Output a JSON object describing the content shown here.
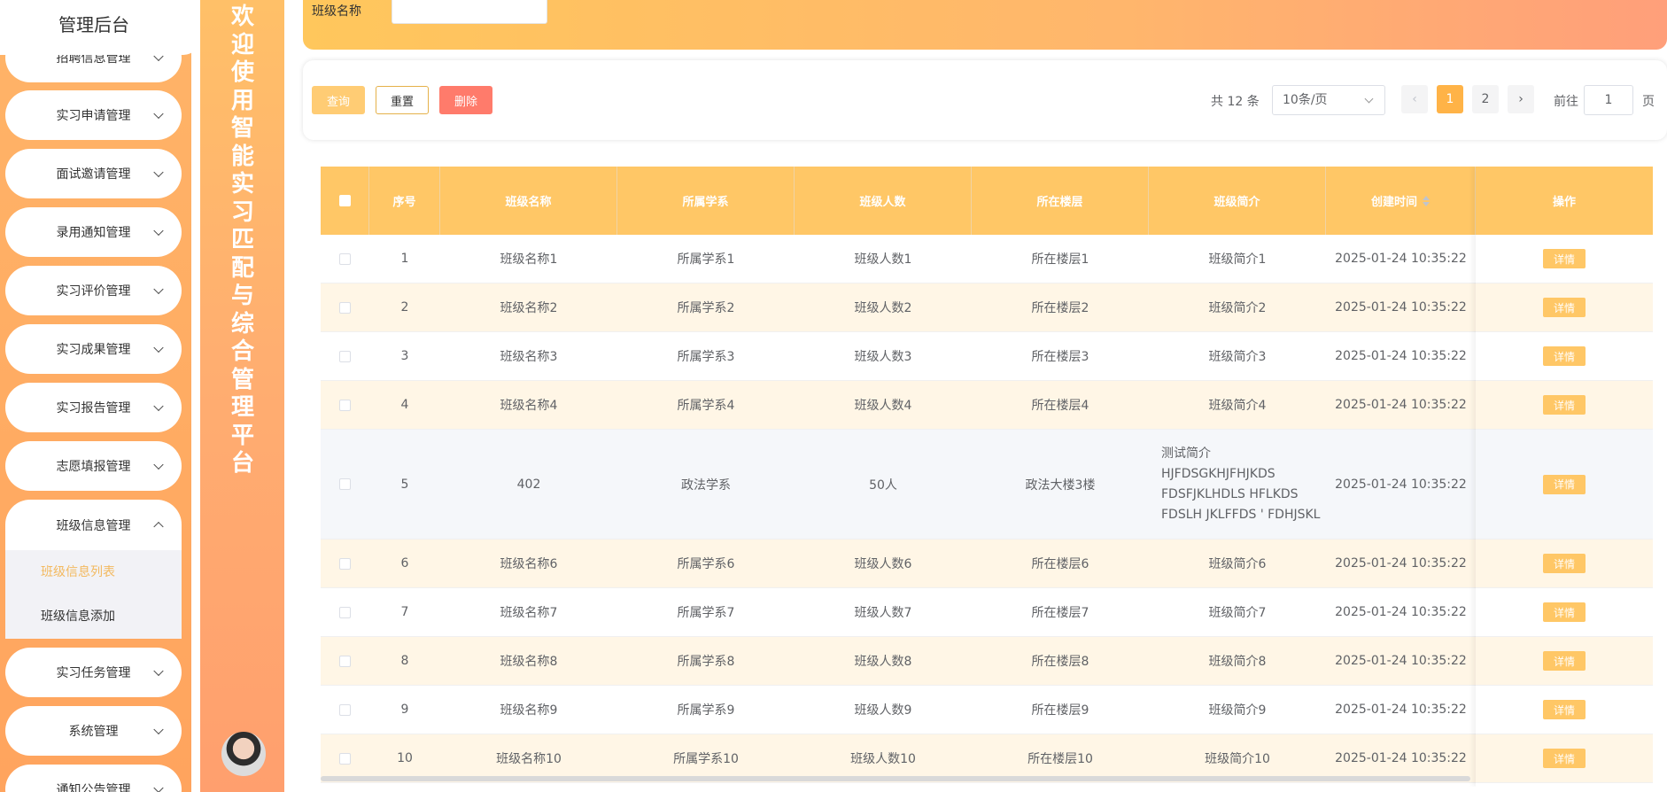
{
  "sidebar": {
    "title": "管理后台",
    "items": [
      {
        "label": "招聘信息管理"
      },
      {
        "label": "实习申请管理"
      },
      {
        "label": "面试邀请管理"
      },
      {
        "label": "录用通知管理"
      },
      {
        "label": "实习评价管理"
      },
      {
        "label": "实习成果管理"
      },
      {
        "label": "实习报告管理"
      },
      {
        "label": "志愿填报管理"
      },
      {
        "label": "班级信息管理"
      },
      {
        "label": "实习任务管理"
      },
      {
        "label": "系统管理"
      },
      {
        "label": "通知公告管理"
      }
    ],
    "submenu": [
      {
        "label": "班级信息列表"
      },
      {
        "label": "班级信息添加"
      }
    ]
  },
  "banner": {
    "text": "欢迎使用智能实习匹配与综合管理平台"
  },
  "search": {
    "label": "班级名称",
    "value": ""
  },
  "toolbar": {
    "query_label": "查询",
    "reset_label": "重置",
    "delete_label": "删除",
    "total_text": "共 12 条",
    "page_size": "10条/页",
    "prev": "‹",
    "next": "›",
    "pages": [
      "1",
      "2"
    ],
    "current_page": 1,
    "goto_label": "前往",
    "goto_value": "1",
    "goto_unit": "页"
  },
  "table": {
    "headers": [
      "序号",
      "班级名称",
      "所属学系",
      "班级人数",
      "所在楼层",
      "班级简介",
      "创建时间",
      "操作"
    ],
    "detail_label": "详情",
    "rows": [
      {
        "index": "1",
        "name": "班级名称1",
        "dept": "所属学系1",
        "count": "班级人数1",
        "floor": "所在楼层1",
        "intro": "班级简介1",
        "created": "2025-01-24 10:35:22"
      },
      {
        "index": "2",
        "name": "班级名称2",
        "dept": "所属学系2",
        "count": "班级人数2",
        "floor": "所在楼层2",
        "intro": "班级简介2",
        "created": "2025-01-24 10:35:22"
      },
      {
        "index": "3",
        "name": "班级名称3",
        "dept": "所属学系3",
        "count": "班级人数3",
        "floor": "所在楼层3",
        "intro": "班级简介3",
        "created": "2025-01-24 10:35:22"
      },
      {
        "index": "4",
        "name": "班级名称4",
        "dept": "所属学系4",
        "count": "班级人数4",
        "floor": "所在楼层4",
        "intro": "班级简介4",
        "created": "2025-01-24 10:35:22"
      },
      {
        "index": "5",
        "name": "402",
        "dept": "政法学系",
        "count": "50人",
        "floor": "政法大楼3楼",
        "intro": "测试简介\nHJFDSGKHJFHJKDS\nFDSFJKLHDLS HFLKDS\nFDSLH JKLFFDS ' FDHJSKL",
        "created": "2025-01-24 10:35:22"
      },
      {
        "index": "6",
        "name": "班级名称6",
        "dept": "所属学系6",
        "count": "班级人数6",
        "floor": "所在楼层6",
        "intro": "班级简介6",
        "created": "2025-01-24 10:35:22"
      },
      {
        "index": "7",
        "name": "班级名称7",
        "dept": "所属学系7",
        "count": "班级人数7",
        "floor": "所在楼层7",
        "intro": "班级简介7",
        "created": "2025-01-24 10:35:22"
      },
      {
        "index": "8",
        "name": "班级名称8",
        "dept": "所属学系8",
        "count": "班级人数8",
        "floor": "所在楼层8",
        "intro": "班级简介8",
        "created": "2025-01-24 10:35:22"
      },
      {
        "index": "9",
        "name": "班级名称9",
        "dept": "所属学系9",
        "count": "班级人数9",
        "floor": "所在楼层9",
        "intro": "班级简介9",
        "created": "2025-01-24 10:35:22"
      },
      {
        "index": "10",
        "name": "班级名称10",
        "dept": "所属学系10",
        "count": "班级人数10",
        "floor": "所在楼层10",
        "intro": "班级简介10",
        "created": "2025-01-24 10:35:22"
      }
    ]
  }
}
